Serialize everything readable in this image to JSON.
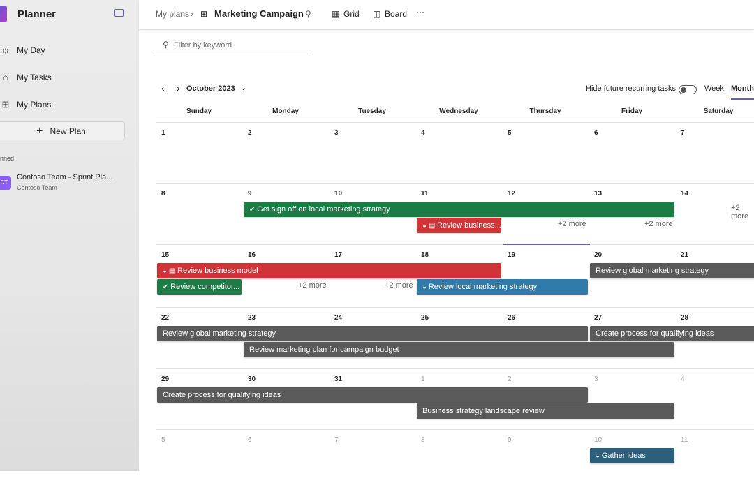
{
  "sidebar": {
    "title": "Planner",
    "items": [
      {
        "label": "My Day",
        "icon": "sun-icon"
      },
      {
        "label": "My Tasks",
        "icon": "task-icon"
      },
      {
        "label": "My Plans",
        "icon": "grid-icon"
      }
    ],
    "new_plan": "New Plan",
    "pinned_label": "nned",
    "plan": {
      "name": "Contoso Team - Sprint Pla...",
      "team": "Contoso Team",
      "icon_text": "CT"
    }
  },
  "header": {
    "breadcrumb_root": "My plans",
    "title": "Marketing Campaign",
    "tabs": [
      "Grid",
      "Board"
    ],
    "more": "···"
  },
  "filter": {
    "placeholder": "Filter by keyword"
  },
  "calendar": {
    "month": "October 2023",
    "hide_recurring": "Hide future recurring tasks",
    "hide_recurring_on": false,
    "views": [
      "Week",
      "Month"
    ],
    "selected_view": "Month",
    "today": 19,
    "days": [
      "Sunday",
      "Monday",
      "Tuesday",
      "Wednesday",
      "Thursday",
      "Friday",
      "Saturday"
    ],
    "weeks": [
      {
        "dates": [
          1,
          2,
          3,
          4,
          5,
          6,
          7
        ],
        "dim": [],
        "events": [],
        "more": []
      },
      {
        "dates": [
          8,
          9,
          10,
          11,
          12,
          13,
          14
        ],
        "dim": [],
        "events": [
          {
            "title": "Get sign off on local marketing strategy",
            "start": 1,
            "span": 5,
            "lane": 0,
            "color": "#1b7d45",
            "icon": "check"
          },
          {
            "title": "Review business...",
            "start": 3,
            "span": 1,
            "lane": 1,
            "color": "#d13438",
            "icon": "half-cal"
          }
        ],
        "more": [
          {
            "col": 4,
            "lane": 1,
            "text": "+2 more"
          },
          {
            "col": 5,
            "lane": 1,
            "text": "+2 more"
          },
          {
            "col": 6,
            "lane": 0,
            "text": "+2 more"
          }
        ]
      },
      {
        "dates": [
          15,
          16,
          17,
          18,
          19,
          20,
          21
        ],
        "dim": [],
        "events": [
          {
            "title": "Review business model",
            "start": 0,
            "span": 4,
            "lane": 0,
            "color": "#d13438",
            "icon": "half-cal"
          },
          {
            "title": "Review competitor...",
            "start": 0,
            "span": 1,
            "lane": 1,
            "color": "#1b7d45",
            "icon": "check"
          },
          {
            "title": "Review local marketing strategy",
            "start": 3,
            "span": 2,
            "lane": 1,
            "color": "#2e7aa8",
            "icon": "half"
          },
          {
            "title": "Review global marketing strategy",
            "start": 5,
            "span": 2,
            "lane": 0,
            "color": "#5a5a5a",
            "icon": ""
          }
        ],
        "more": [
          {
            "col": 1,
            "lane": 1,
            "text": "+2 more"
          },
          {
            "col": 2,
            "lane": 1,
            "text": "+2 more"
          }
        ]
      },
      {
        "dates": [
          22,
          23,
          24,
          25,
          26,
          27,
          28
        ],
        "dim": [],
        "events": [
          {
            "title": "Review global marketing strategy",
            "start": 0,
            "span": 5,
            "lane": 0,
            "color": "#5a5a5a",
            "icon": ""
          },
          {
            "title": "Create process for qualifying ideas",
            "start": 5,
            "span": 2,
            "lane": 0,
            "color": "#5a5a5a",
            "icon": ""
          },
          {
            "title": "Review marketing plan for campaign budget",
            "start": 1,
            "span": 5,
            "lane": 1,
            "color": "#5a5a5a",
            "icon": ""
          }
        ],
        "more": []
      },
      {
        "dates": [
          29,
          30,
          31,
          1,
          2,
          3,
          4
        ],
        "dim": [
          3,
          4,
          5,
          6
        ],
        "events": [
          {
            "title": "Create process for qualifying ideas",
            "start": 0,
            "span": 5,
            "lane": 0,
            "color": "#5a5a5a",
            "icon": ""
          },
          {
            "title": "Business strategy landscape review",
            "start": 3,
            "span": 3,
            "lane": 1,
            "color": "#5a5a5a",
            "icon": ""
          }
        ],
        "more": []
      },
      {
        "dates": [
          5,
          6,
          7,
          8,
          9,
          10,
          11
        ],
        "dim": [
          0,
          1,
          2,
          3,
          4,
          5,
          6
        ],
        "events": [
          {
            "title": "Gather ideas",
            "start": 5,
            "span": 1,
            "lane": 0,
            "color": "#2c5f7c",
            "icon": "half"
          }
        ],
        "more": []
      }
    ]
  }
}
